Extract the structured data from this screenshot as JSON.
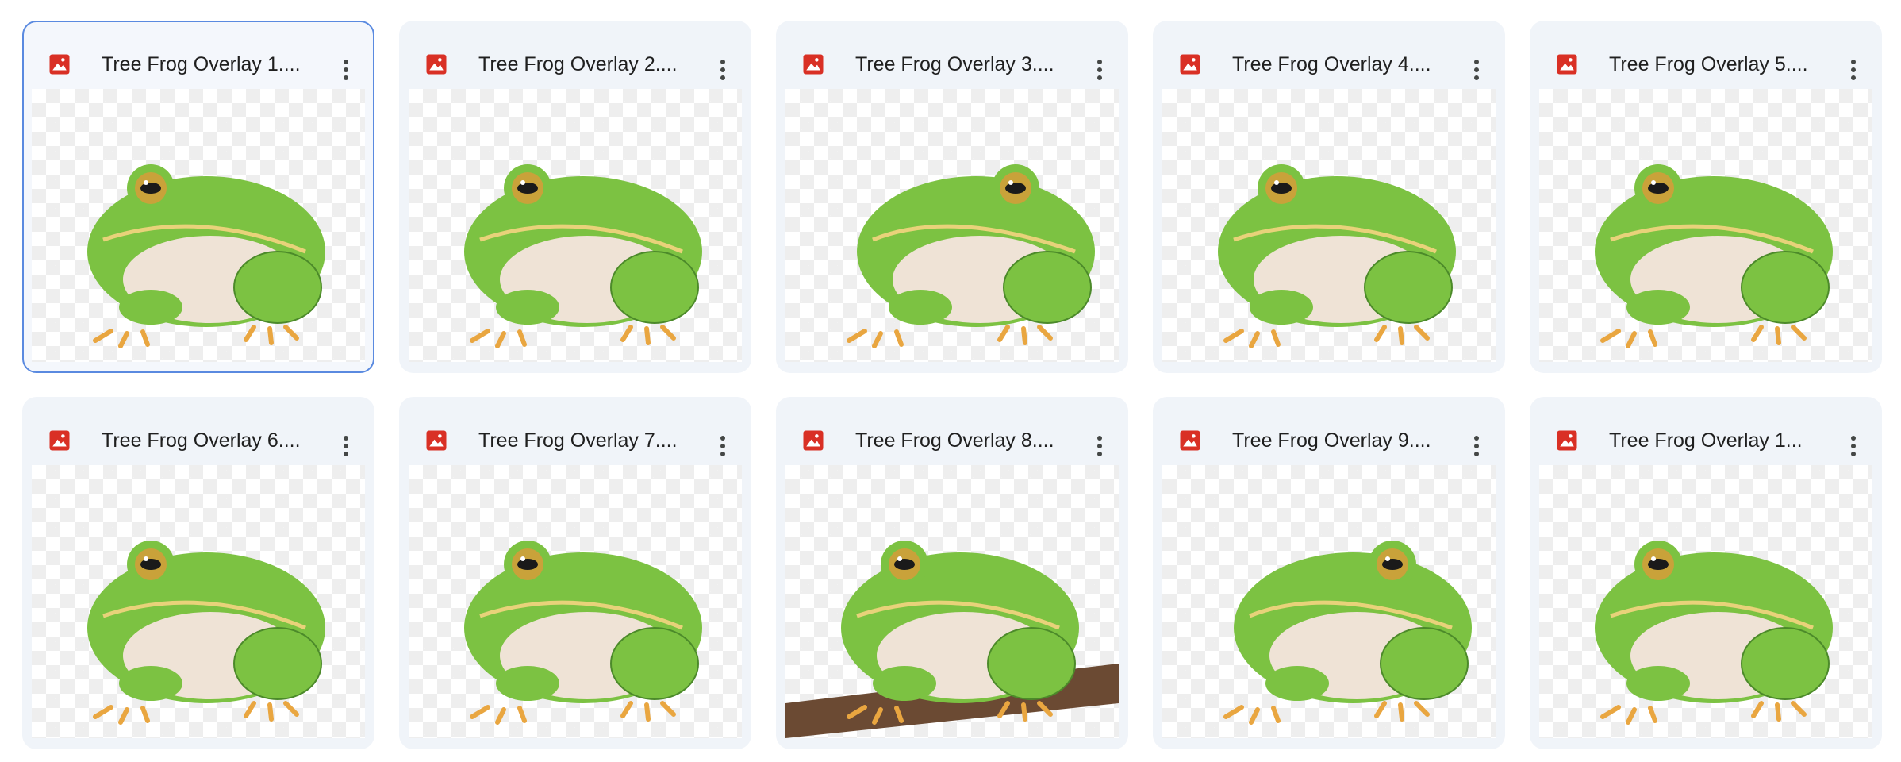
{
  "files": [
    {
      "title": "Tree Frog Overlay 1....",
      "selected": true,
      "variant": "a"
    },
    {
      "title": "Tree Frog Overlay 2....",
      "selected": false,
      "variant": "b"
    },
    {
      "title": "Tree Frog Overlay 3....",
      "selected": false,
      "variant": "c"
    },
    {
      "title": "Tree Frog Overlay 4....",
      "selected": false,
      "variant": "b"
    },
    {
      "title": "Tree Frog Overlay 5....",
      "selected": false,
      "variant": "b"
    },
    {
      "title": "Tree Frog Overlay 6....",
      "selected": false,
      "variant": "b"
    },
    {
      "title": "Tree Frog Overlay 7....",
      "selected": false,
      "variant": "a"
    },
    {
      "title": "Tree Frog Overlay 8....",
      "selected": false,
      "variant": "branch"
    },
    {
      "title": "Tree Frog Overlay 9....",
      "selected": false,
      "variant": "c"
    },
    {
      "title": "Tree Frog Overlay 1...",
      "selected": false,
      "variant": "b"
    }
  ],
  "icons": {
    "file_type": "image-file-icon",
    "more": "more-vert-icon"
  },
  "colors": {
    "card_bg": "#f0f4f9",
    "selected_border": "#5a8ae0",
    "image_icon": "#d93025",
    "frog_green": "#7cc242",
    "frog_dark": "#4c8a2a",
    "frog_belly": "#efe3d6",
    "frog_toes": "#e9a640",
    "branch": "#6b4a33"
  }
}
